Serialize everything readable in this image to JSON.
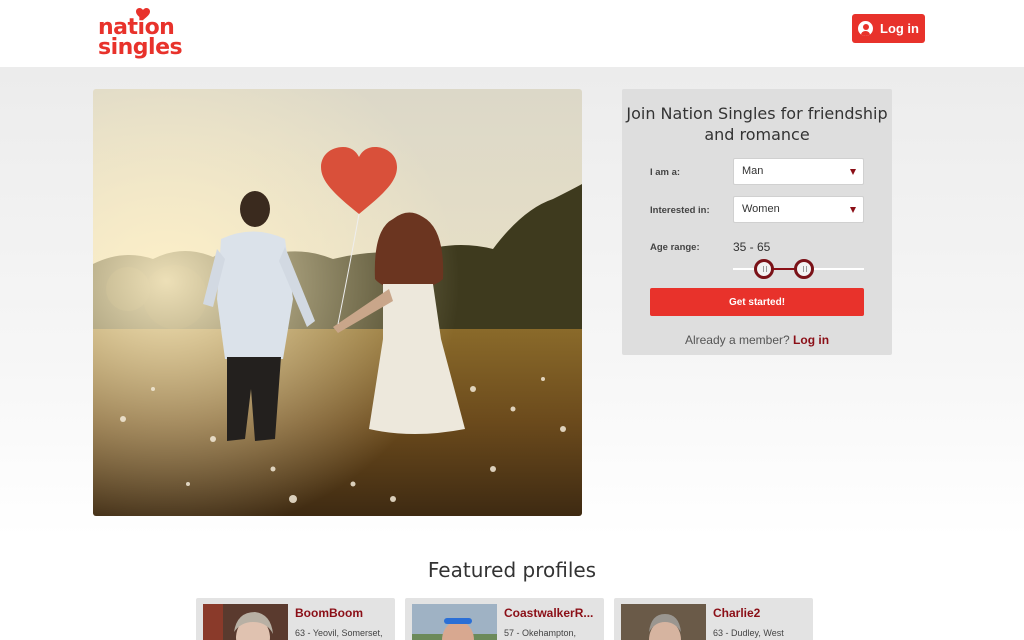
{
  "brand": {
    "logo_line1": "nation",
    "logo_line2": "singles",
    "accent_color": "#e8322b",
    "dark_accent_color": "#8b0f17"
  },
  "header": {
    "login_label": "Log in",
    "login_icon": "user-circle-icon"
  },
  "signup": {
    "title": "Join Nation Singles for friendship and romance",
    "i_am_label": "I am a:",
    "i_am_value": "Man",
    "interested_label": "Interested in:",
    "interested_value": "Women",
    "age_label": "Age range:",
    "age_value": "35 - 65",
    "age_min": 35,
    "age_max": 65,
    "submit_label": "Get started!",
    "member_text": "Already a member?",
    "member_link": "Log in"
  },
  "featured": {
    "title": "Featured profiles",
    "profiles": [
      {
        "name": "BoomBoom",
        "location": "63 - Yeovil, Somerset,"
      },
      {
        "name": "CoastwalkerR...",
        "location": "57 - Okehampton,"
      },
      {
        "name": "Charlie2",
        "location": "63 - Dudley, West"
      }
    ]
  }
}
